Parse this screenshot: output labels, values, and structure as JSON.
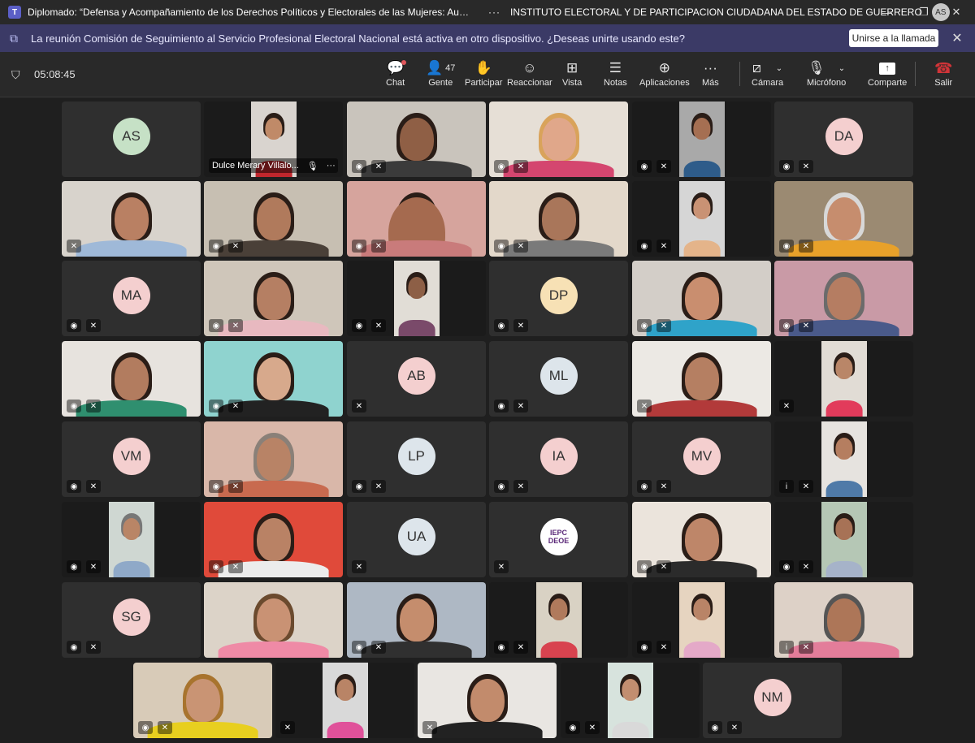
{
  "titlebar": {
    "app_icon": "teams-icon",
    "title": "Diplomado: “Defensa y Acompañamiento de los Derechos Políticos y Electorales de las Mujeres: Aurora ...",
    "more": "···",
    "organization": "INSTITUTO ELECTORAL Y DE PARTICIPACION CIUDADANA DEL ESTADO DE GUERRERO",
    "user_initials": "AS",
    "minimize": "—",
    "restore": "❐",
    "close": "✕"
  },
  "banner": {
    "text": "La reunión Comisión de Seguimiento al Servicio Profesional Electoral Nacional está activa en otro dispositivo. ¿Deseas unirte usando este?",
    "join_button": "Unirse a la llamada",
    "close": "✕"
  },
  "toolbar": {
    "timer": "05:08:45",
    "people_count": "47",
    "items": {
      "chat": "Chat",
      "people": "Gente",
      "raise": "Participar",
      "react": "Reaccionar",
      "view": "Vista",
      "notes": "Notas",
      "apps": "Aplicaciones",
      "more": "Más",
      "camera": "Cámara",
      "mic": "Micrófono",
      "share": "Comparte",
      "leave": "Salir"
    }
  },
  "colors": {
    "background": "#1f1f1f",
    "titlebar": "#292929",
    "banner": "#3b3a66",
    "tile": "#2f2f2f",
    "leave": "#d13438"
  },
  "participants": {
    "as": "AS",
    "da": "DA",
    "ma": "MA",
    "dp": "DP",
    "ab": "AB",
    "ml": "ML",
    "vm": "VM",
    "lp": "LP",
    "ia": "IA",
    "mv": "MV",
    "ua": "UA",
    "sg": "SG",
    "nm": "NM",
    "dulce_name": "Dulce Merary Villalo...",
    "dulce_more": "···",
    "logo_line1": "IEPC",
    "logo_line2": "DEOE"
  }
}
